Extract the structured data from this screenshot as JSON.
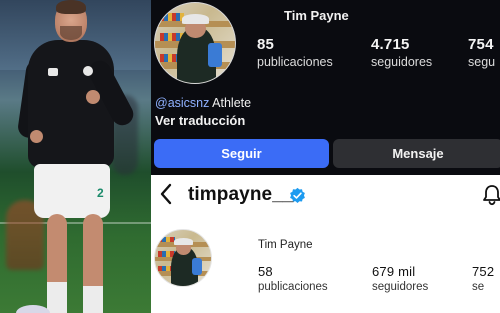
{
  "top_profile": {
    "name": "Tim Payne",
    "stats": [
      {
        "value": "85",
        "label": "publicaciones"
      },
      {
        "value": "4.715",
        "label": "seguidores"
      },
      {
        "value": "754",
        "label": "segu"
      }
    ],
    "bio_handle": "@asicsnz",
    "bio_text": " Athlete",
    "translate_label": "Ver traducción",
    "follow_button": "Seguir",
    "message_button": "Mensaje",
    "colors": {
      "background": "#0a0b10",
      "follow": "#3b6cf6",
      "message": "#2e2f33",
      "handle": "#8fb1ff"
    }
  },
  "bottom_profile": {
    "username": "timpayne__",
    "name": "Tim Payne",
    "stats": [
      {
        "value": "58",
        "label": "publicaciones"
      },
      {
        "value": "679 mil",
        "label": "seguidores"
      },
      {
        "value": "752",
        "label": "se"
      }
    ],
    "icons": [
      "back-icon",
      "verified-icon",
      "bell-icon"
    ],
    "colors": {
      "background": "#ffffff",
      "verified": "#1d9bf0"
    }
  },
  "photo": {
    "shorts_number": "2"
  }
}
